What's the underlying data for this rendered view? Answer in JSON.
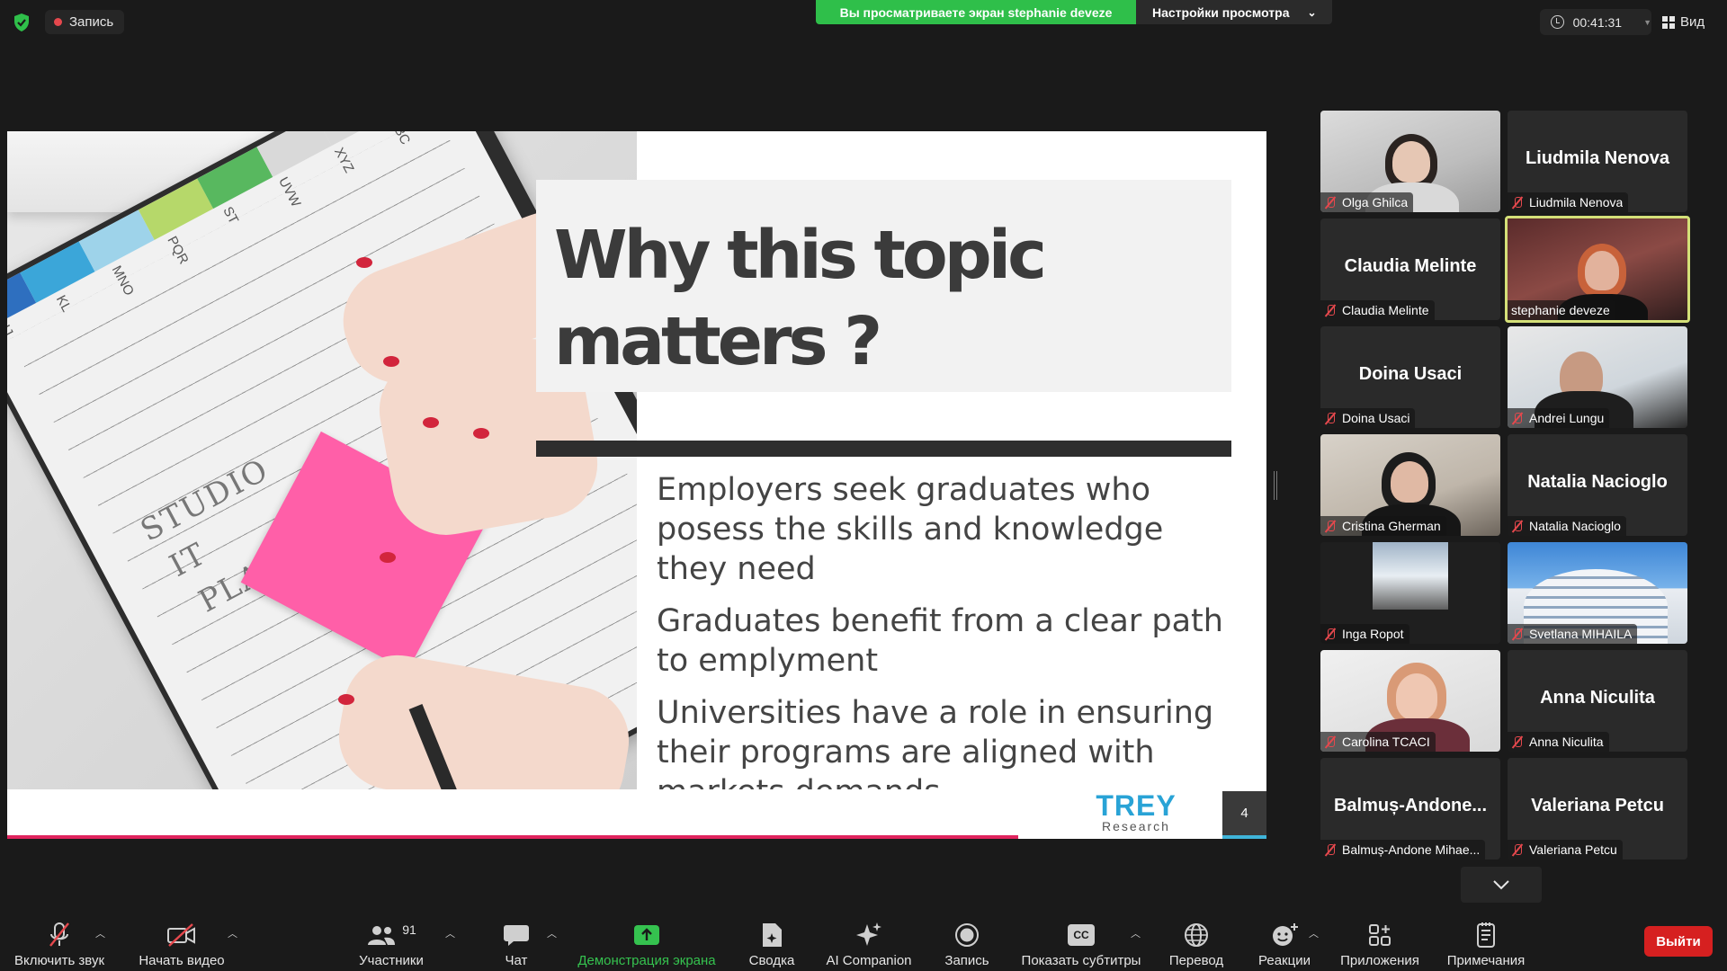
{
  "topbar": {
    "recording_label": "Запись",
    "share_banner": "Вы просматриваете экран stephanie deveze",
    "view_options": "Настройки просмотра",
    "timer": "00:41:31",
    "view_label": "Вид"
  },
  "slide": {
    "title_line1": "Why this topic",
    "title_line2": "matters ?",
    "bullets": [
      "Employers seek graduates who posess the skills and knowledge they need",
      "Graduates benefit from a clear path to emplyment",
      "Universities have a role in ensuring their programs are aligned with markets demands"
    ],
    "logo_main": "TREY",
    "logo_sub": "Research",
    "page_number": "4",
    "notebook_tabs": [
      "IJ",
      "KL",
      "MNO",
      "PQR",
      "ST",
      "UVW",
      "XYZ",
      "ABC"
    ],
    "notebook_text": [
      "STUDIO",
      "IT",
      "PLAN"
    ]
  },
  "participants": [
    {
      "name": "Olga Ghilca",
      "big": "",
      "video": true
    },
    {
      "name": "Liudmila Nenova",
      "big": "Liudmila Nenova",
      "video": false
    },
    {
      "name": "Claudia Melinte",
      "big": "Claudia Melinte",
      "video": false
    },
    {
      "name": "stephanie deveze",
      "big": "",
      "video": true,
      "active": true
    },
    {
      "name": "Doina Usaci",
      "big": "Doina Usaci",
      "video": false
    },
    {
      "name": "Andrei Lungu",
      "big": "",
      "video": true
    },
    {
      "name": "Cristina Gherman",
      "big": "",
      "video": true
    },
    {
      "name": "Natalia Nacioglo",
      "big": "Natalia Nacioglo",
      "video": false
    },
    {
      "name": "Inga Ropot",
      "big": "",
      "video": true
    },
    {
      "name": "Svetlana MIHAILA",
      "big": "",
      "video": true
    },
    {
      "name": "Carolina TCACI",
      "big": "",
      "video": true
    },
    {
      "name": "Anna Niculita",
      "big": "Anna Niculita",
      "video": false
    },
    {
      "name": "Balmuș-Andone Mihae...",
      "big": "Balmuș-Andone...",
      "video": false
    },
    {
      "name": "Valeriana Petcu",
      "big": "Valeriana Petcu",
      "video": false
    }
  ],
  "toolbar": {
    "unmute": "Включить звук",
    "start_video": "Начать видео",
    "participants": "Участники",
    "participants_count": "91",
    "chat": "Чат",
    "share_screen": "Демонстрация экрана",
    "summary": "Сводка",
    "ai_companion": "AI Companion",
    "record": "Запись",
    "captions": "Показать субтитры",
    "captions_icon_text": "CC",
    "translate": "Перевод",
    "reactions": "Реакции",
    "apps": "Приложения",
    "notes": "Примечания",
    "exit": "Выйти"
  },
  "colors": {
    "share_green": "#2fbf4a",
    "exit_red": "#d62020",
    "active_speaker": "#d4e078",
    "slide_pink": "#e0245e",
    "logo_blue": "#29a3d6"
  }
}
